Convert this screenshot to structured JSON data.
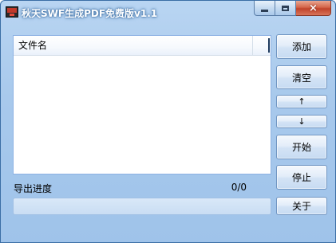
{
  "window": {
    "title": "秋天SWF生成PDF免费版v1.1",
    "icon": "pdf-app-icon",
    "controls": {
      "minimize": "minimize-icon",
      "maximize": "maximize-icon",
      "close": "×"
    }
  },
  "file_list": {
    "columns": [
      "文件名"
    ],
    "rows": []
  },
  "buttons": {
    "add": "添加",
    "clear": "清空",
    "up": "↑",
    "down": "↓",
    "start": "开始",
    "stop": "停止",
    "about": "关于"
  },
  "progress": {
    "label": "导出进度",
    "count": "0/0",
    "fraction": 0
  },
  "colors": {
    "window_bg": "#a8c9ec",
    "close_button": "#c0432a",
    "list_border": "#8db2e3"
  }
}
